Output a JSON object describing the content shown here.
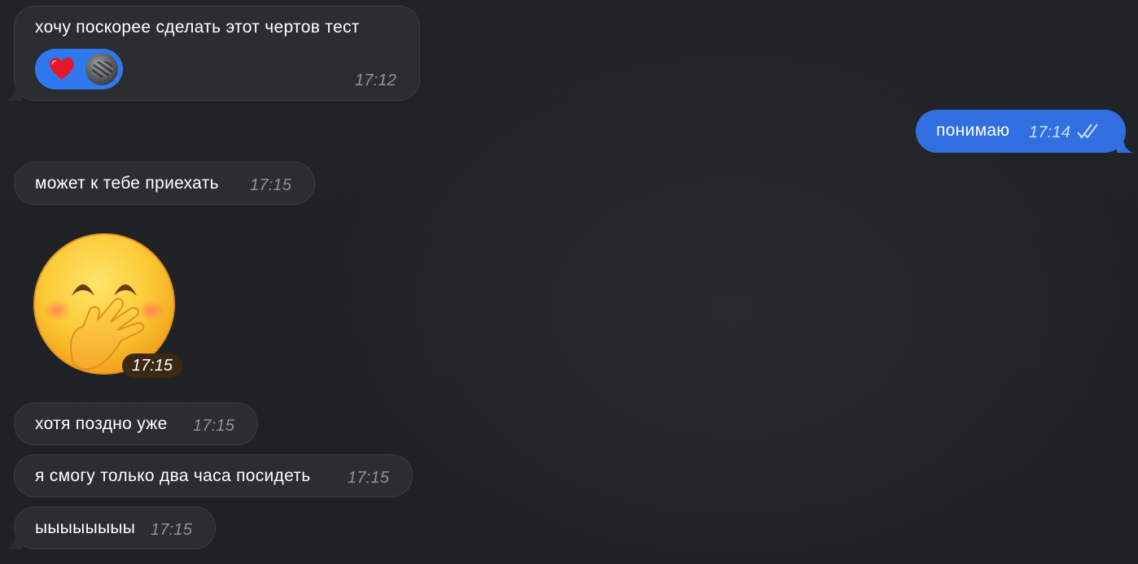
{
  "messages": [
    {
      "text": "хочу поскорее сделать этот чертов тест",
      "time": "17:12"
    },
    {
      "text": "понимаю",
      "time": "17:14"
    },
    {
      "text": "может к тебе приехать",
      "time": "17:15"
    },
    {
      "sticker": "hand-over-mouth-emoji",
      "time": "17:15"
    },
    {
      "text": "хотя поздно уже",
      "time": "17:15"
    },
    {
      "text": "я смогу только два часа посидеть",
      "time": "17:15"
    },
    {
      "text": "ыыыыыыыы",
      "time": "17:15"
    }
  ],
  "reaction": {
    "icon": "heart-icon",
    "color": "#2f79f0"
  },
  "colors": {
    "incoming_bubble": "#2b2d30",
    "outgoing_bubble": "#2f6fe0",
    "background": "#1f2326"
  }
}
